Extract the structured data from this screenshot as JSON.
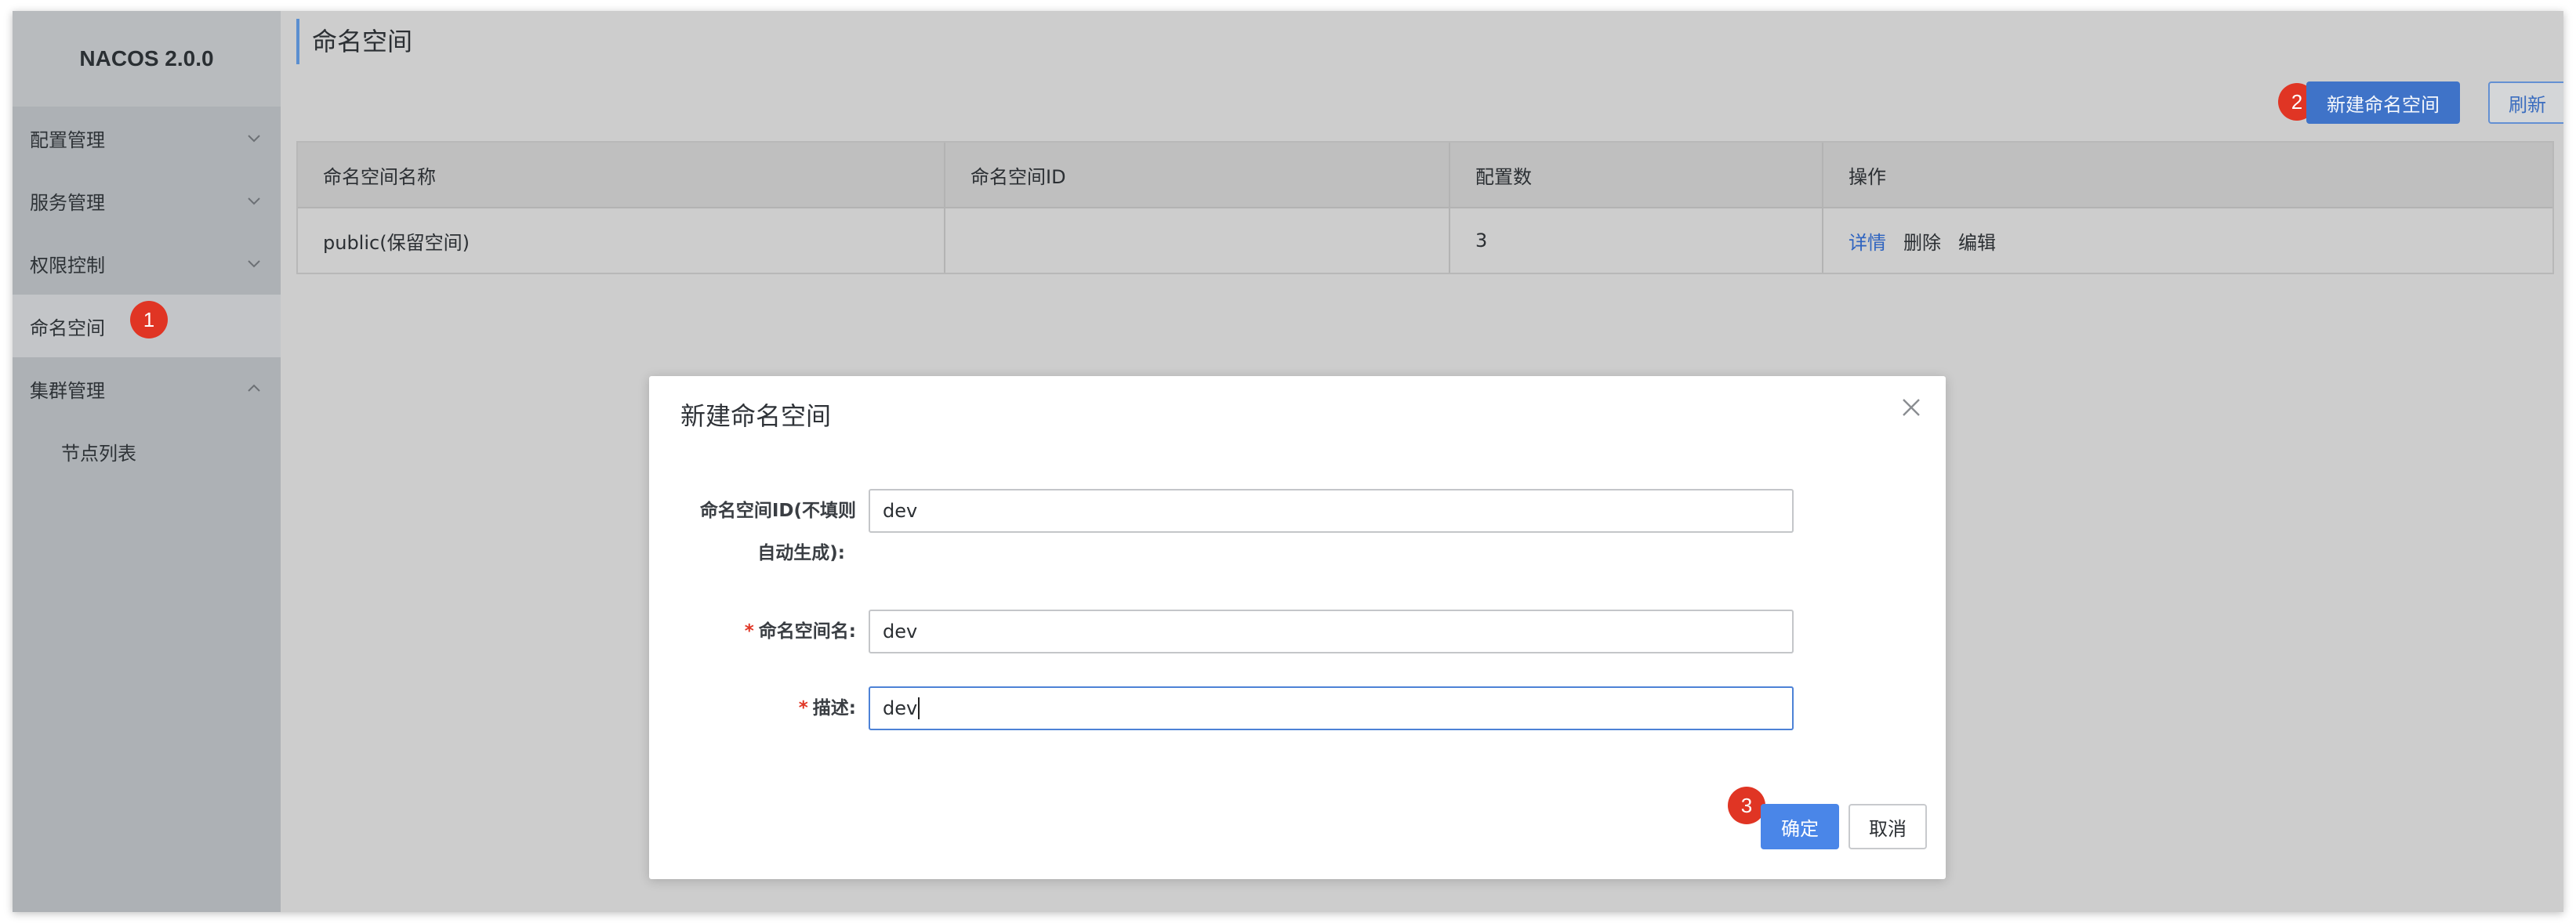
{
  "brand": "NACOS 2.0.0",
  "sidebar": {
    "items": [
      {
        "label": "配置管理"
      },
      {
        "label": "服务管理"
      },
      {
        "label": "权限控制"
      },
      {
        "label": "命名空间"
      },
      {
        "label": "集群管理"
      }
    ],
    "sub_items": [
      {
        "label": "节点列表"
      }
    ]
  },
  "markers": [
    "1",
    "2",
    "3"
  ],
  "page": {
    "title": "命名空间"
  },
  "toolbar": {
    "create_label": "新建命名空间",
    "refresh_label": "刷新"
  },
  "table": {
    "headers": [
      "命名空间名称",
      "命名空间ID",
      "配置数",
      "操作"
    ],
    "rows": [
      {
        "name": "public(保留空间)",
        "id": "",
        "count": "3",
        "ops": [
          "详情",
          "删除",
          "编辑"
        ]
      }
    ]
  },
  "modal": {
    "title": "新建命名空间",
    "fields": [
      {
        "label_line1": "命名空间ID(不填则",
        "label_line2": "自动生成):",
        "value": "dev"
      },
      {
        "label": "命名空间名:",
        "value": "dev"
      },
      {
        "label": "描述:",
        "value": "dev"
      }
    ],
    "required_mark": "*",
    "ok_label": "确定",
    "cancel_label": "取消"
  },
  "colors": {
    "accent": "#3f73c8",
    "badge": "#e03524",
    "sidebar": "#adb1b5"
  }
}
